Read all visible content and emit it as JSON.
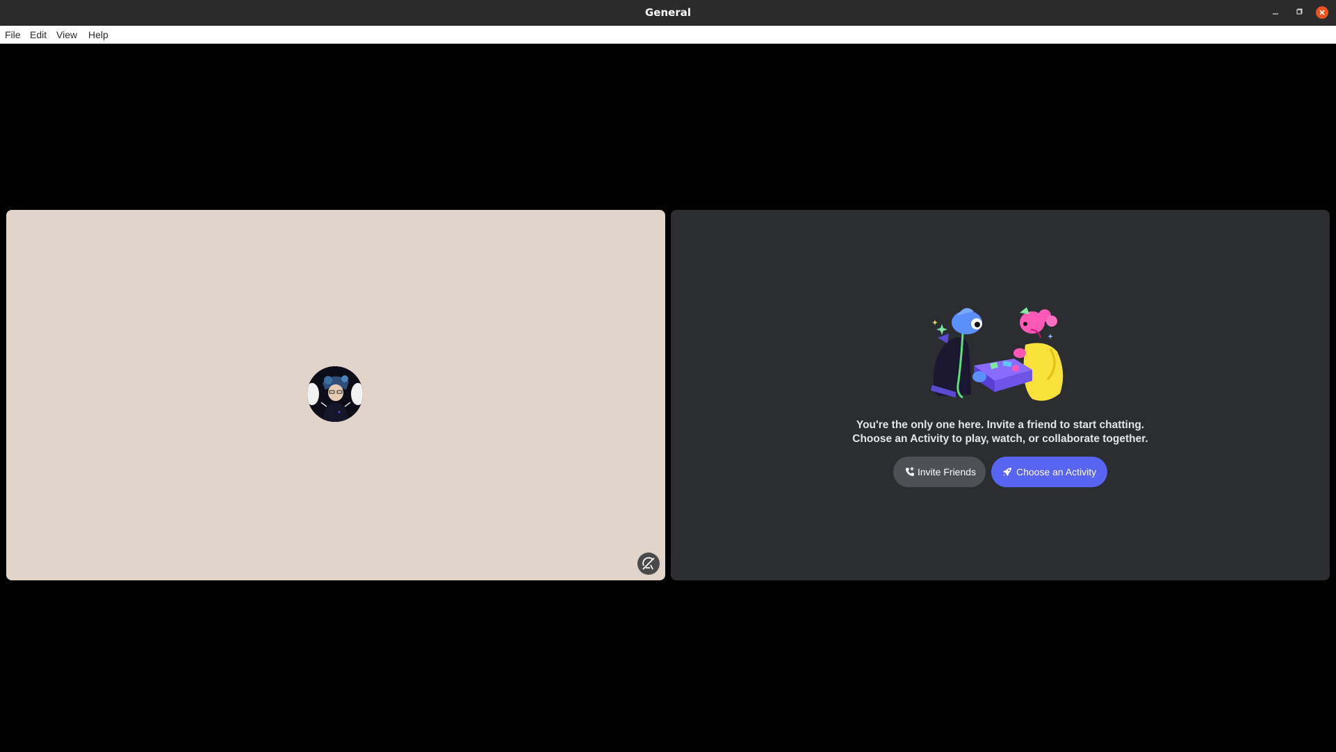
{
  "window": {
    "title": "General",
    "controls": {
      "minimize_icon": "minimize-icon",
      "maximize_icon": "maximize-icon",
      "close_icon": "close-icon"
    }
  },
  "menu": {
    "items": [
      {
        "label": "File"
      },
      {
        "label": "Edit"
      },
      {
        "label": "View"
      },
      {
        "label": "Help"
      }
    ]
  },
  "call": {
    "user_tile": {
      "background_color": "#e1d4cb",
      "avatar_icon": "user-avatar",
      "stream_status_icon": "screen-share-off-icon"
    },
    "invite_tile": {
      "background_color": "#2b2d31",
      "message_line1": "You're the only one here. Invite a friend to start chatting.",
      "message_line2": "Choose an Activity to play, watch, or collaborate together.",
      "invite_button_label": "Invite Friends",
      "invite_button_icon": "phone-add-icon",
      "activity_button_label": "Choose an Activity",
      "activity_button_icon": "rocket-icon",
      "activity_button_color": "#5865f2"
    }
  }
}
